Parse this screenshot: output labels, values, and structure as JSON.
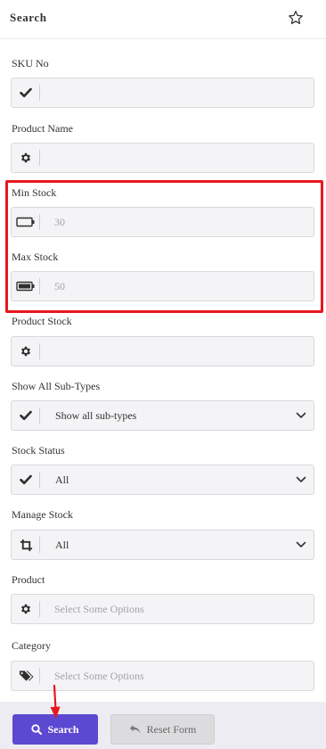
{
  "panel": {
    "title": "Search",
    "star_icon": "star-outline-icon"
  },
  "fields": {
    "sku_no": {
      "label": "SKU No",
      "icon": "check-icon",
      "value": ""
    },
    "product_name": {
      "label": "Product Name",
      "icon": "gear-icon",
      "value": ""
    },
    "min_stock": {
      "label": "Min Stock",
      "icon": "battery-empty-icon",
      "placeholder": "30"
    },
    "max_stock": {
      "label": "Max Stock",
      "icon": "battery-full-icon",
      "placeholder": "50"
    },
    "product_stock": {
      "label": "Product Stock",
      "icon": "gear-icon",
      "value": ""
    },
    "show_all_sub_types": {
      "label": "Show All Sub-Types",
      "icon": "check-icon",
      "selected": "Show all sub-types"
    },
    "stock_status": {
      "label": "Stock Status",
      "icon": "check-icon",
      "selected": "All"
    },
    "manage_stock": {
      "label": "Manage Stock",
      "icon": "crop-icon",
      "selected": "All"
    },
    "product": {
      "label": "Product",
      "icon": "gear-icon",
      "placeholder": "Select Some Options"
    },
    "category": {
      "label": "Category",
      "icon": "tags-icon",
      "placeholder": "Select Some Options"
    }
  },
  "actions": {
    "search_label": "Search",
    "search_icon": "search-icon",
    "reset_label": "Reset Form",
    "reset_icon": "undo-icon"
  },
  "annotations": {
    "highlight_color": "#e8161c",
    "arrow_color": "#e8161c"
  },
  "colors": {
    "primary": "#5d48d1",
    "field_bg": "#f4f4f6",
    "footer_bg": "#ececf2"
  }
}
